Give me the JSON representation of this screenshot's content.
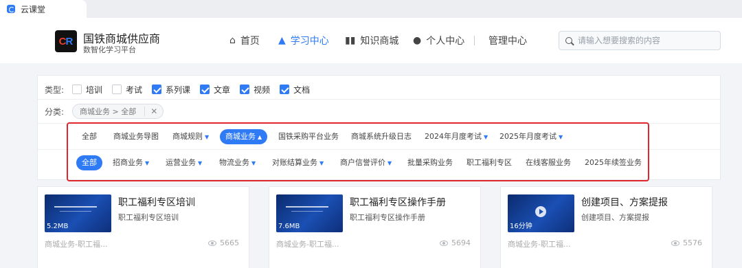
{
  "browser": {
    "tab_title": "云课堂"
  },
  "brand": {
    "name": "国铁商城供应商",
    "subtitle": "数智化学习平台"
  },
  "nav": [
    {
      "label": "首页",
      "icon": "home-icon",
      "active": false
    },
    {
      "label": "学习中心",
      "icon": "graduation-cap-icon",
      "active": true
    },
    {
      "label": "知识商城",
      "icon": "library-icon",
      "active": false
    },
    {
      "label": "个人中心",
      "icon": "user-icon",
      "active": false
    },
    {
      "label": "管理中心",
      "icon": "",
      "active": false
    }
  ],
  "search": {
    "placeholder": "请输入想要搜索的内容"
  },
  "filters": {
    "type_label": "类型:",
    "types": [
      {
        "label": "培训",
        "checked": false
      },
      {
        "label": "考试",
        "checked": false
      },
      {
        "label": "系列课",
        "checked": true
      },
      {
        "label": "文章",
        "checked": true
      },
      {
        "label": "视频",
        "checked": true
      },
      {
        "label": "文档",
        "checked": true
      }
    ],
    "category_label": "分类:",
    "category_chip": "商城业务 > 全部",
    "category_row_1": [
      {
        "label": "全部",
        "dropdown": false,
        "selected": false
      },
      {
        "label": "商城业务导图",
        "dropdown": false,
        "selected": false
      },
      {
        "label": "商城规则",
        "dropdown": true,
        "selected": false
      },
      {
        "label": "商城业务",
        "dropdown": true,
        "selected": true
      },
      {
        "label": "国铁采购平台业务",
        "dropdown": false,
        "selected": false
      },
      {
        "label": "商城系统升级日志",
        "dropdown": false,
        "selected": false
      },
      {
        "label": "2024年月度考试",
        "dropdown": true,
        "selected": false
      },
      {
        "label": "2025年月度考试",
        "dropdown": true,
        "selected": false
      }
    ],
    "category_row_2": [
      {
        "label": "全部",
        "dropdown": false,
        "selected": true
      },
      {
        "label": "招商业务",
        "dropdown": true,
        "selected": false
      },
      {
        "label": "运营业务",
        "dropdown": true,
        "selected": false
      },
      {
        "label": "物流业务",
        "dropdown": true,
        "selected": false
      },
      {
        "label": "对账结算业务",
        "dropdown": true,
        "selected": false
      },
      {
        "label": "商户信誉评价",
        "dropdown": true,
        "selected": false
      },
      {
        "label": "批量采购业务",
        "dropdown": false,
        "selected": false
      },
      {
        "label": "职工福利专区",
        "dropdown": false,
        "selected": false
      },
      {
        "label": "在线客服业务",
        "dropdown": false,
        "selected": false
      },
      {
        "label": "2025年续签业务",
        "dropdown": false,
        "selected": false
      }
    ]
  },
  "courses": [
    {
      "title": "职工福利专区培训",
      "subtitle": "职工福利专区培训",
      "badge": "5.2MB",
      "category": "商城业务-职工福...",
      "views": "5665",
      "has_play": false
    },
    {
      "title": "职工福利专区操作手册",
      "subtitle": "职工福利专区操作手册",
      "badge": "7.6MB",
      "category": "商城业务-职工福...",
      "views": "5694",
      "has_play": false
    },
    {
      "title": "创建项目、方案提报",
      "subtitle": "创建项目、方案提报",
      "badge": "16分钟",
      "category": "商城业务-职工福...",
      "views": "5576",
      "has_play": true
    }
  ],
  "colors": {
    "accent": "#2f7bf5",
    "highlight_border": "#e0262b"
  }
}
